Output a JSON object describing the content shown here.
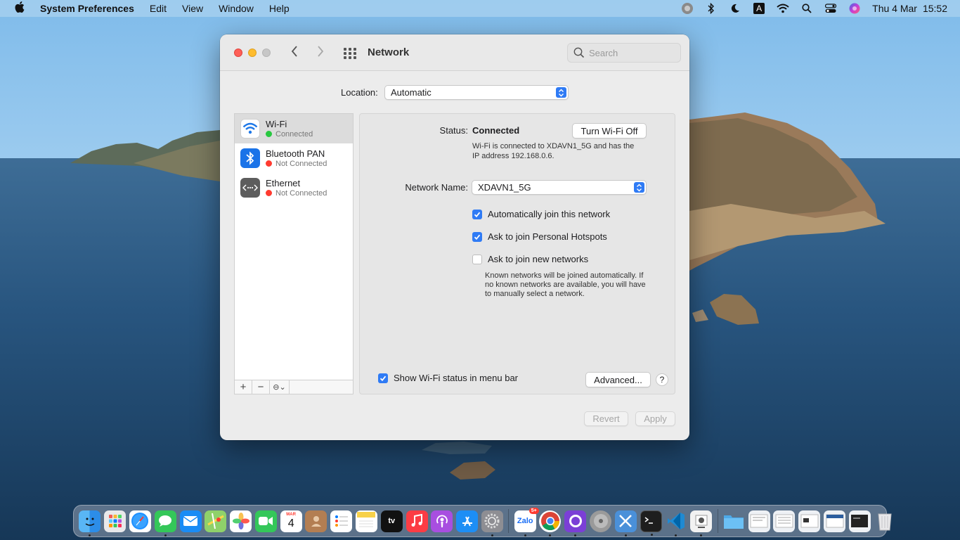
{
  "menubar": {
    "apple": "",
    "app_name": "System Preferences",
    "items": [
      "Edit",
      "View",
      "Window",
      "Help"
    ],
    "status_icons": [
      "siri-orb-icon",
      "bluetooth-icon",
      "do-not-disturb-icon",
      "input-source-icon",
      "wifi-icon",
      "spotlight-icon",
      "control-center-icon",
      "siri-icon"
    ],
    "input_source": "A",
    "date": "Thu 4 Mar",
    "time": "15:52"
  },
  "window": {
    "title": "Network",
    "search_placeholder": "Search",
    "location_label": "Location:",
    "location_value": "Automatic"
  },
  "services": [
    {
      "name": "Wi-Fi",
      "status": "Connected",
      "status_color": "#28c840",
      "icon": "wifi-icon",
      "selected": true
    },
    {
      "name": "Bluetooth PAN",
      "status": "Not Connected",
      "status_color": "#ff3b30",
      "icon": "bluetooth-icon",
      "selected": false
    },
    {
      "name": "Ethernet",
      "status": "Not Connected",
      "status_color": "#ff3b30",
      "icon": "ethernet-icon",
      "selected": false
    }
  ],
  "sidebar_tools": {
    "add": "+",
    "remove": "−",
    "action": "⊖⌄"
  },
  "detail": {
    "status_label": "Status:",
    "status_value": "Connected",
    "turn_off_button": "Turn Wi-Fi Off",
    "status_desc_1": "Wi-Fi is connected to XDAVN1_5G and has the",
    "status_desc_2": "IP address 192.168.0.6.",
    "network_name_label": "Network Name:",
    "network_name_value": "XDAVN1_5G",
    "checks": [
      {
        "label": "Automatically join this network",
        "checked": true
      },
      {
        "label": "Ask to join Personal Hotspots",
        "checked": true
      },
      {
        "label": "Ask to join new networks",
        "checked": false
      }
    ],
    "known_note_1": "Known networks will be joined automatically. If",
    "known_note_2": "no known networks are available, you will have",
    "known_note_3": "to manually select a network.",
    "show_status_label": "Show Wi-Fi status in menu bar",
    "show_status_checked": true,
    "advanced_button": "Advanced...",
    "help_button": "?"
  },
  "footer": {
    "revert": "Revert",
    "apply": "Apply"
  },
  "dock": {
    "calendar_month": "MAR",
    "calendar_day": "4",
    "tv_label": "tv",
    "zalo_label": "Zalo",
    "zalo_badge": "5+",
    "apps": [
      "Finder",
      "Launchpad",
      "Safari",
      "Messages",
      "Mail",
      "Maps",
      "Photos",
      "FaceTime",
      "Calendar",
      "Contacts",
      "Reminders",
      "Notes",
      "TV",
      "Music",
      "Podcasts",
      "App Store",
      "System Preferences",
      "Zalo",
      "Chrome",
      "GitHub Desktop",
      "Disk Utility",
      "Xcode Tools",
      "Terminal",
      "VS Code",
      "Preview",
      "Downloads",
      "Documents",
      "Trash"
    ]
  }
}
